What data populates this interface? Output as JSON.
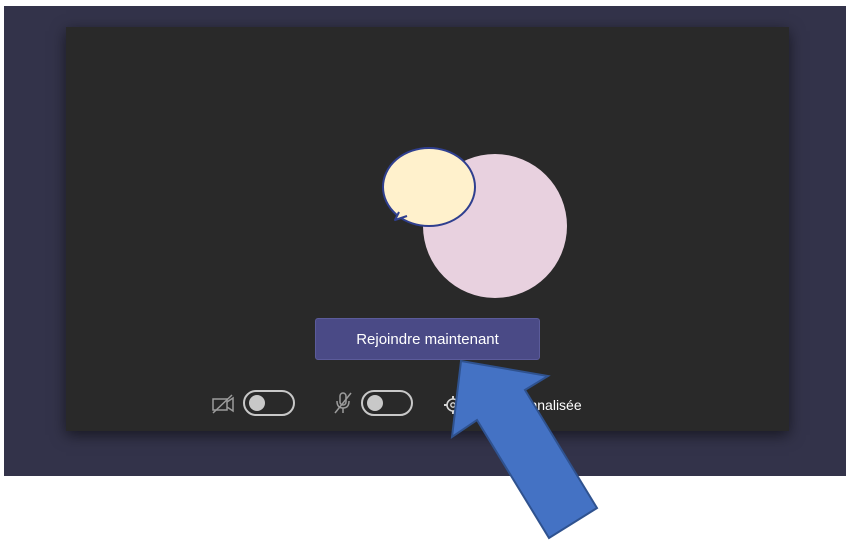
{
  "preview": {
    "join_button_label": "Rejoindre maintenant",
    "camera_toggle_state": "off",
    "mic_toggle_state": "off",
    "settings_label": "Configuration personnalisée",
    "settings_label_visible": "tion personnalisée"
  },
  "avatar": {
    "circle_color": "#e8d1df",
    "bubble_color": "#fff1cc",
    "bubble_outline": "#2f3f8f"
  },
  "annotation": {
    "arrow_color": "#4472c4",
    "arrow_outline": "#2f528f",
    "icon": "arrow-up-left"
  },
  "colors": {
    "screen_bg": "#33334a",
    "preview_bg": "#292929",
    "button_bg": "#4a4a86"
  }
}
